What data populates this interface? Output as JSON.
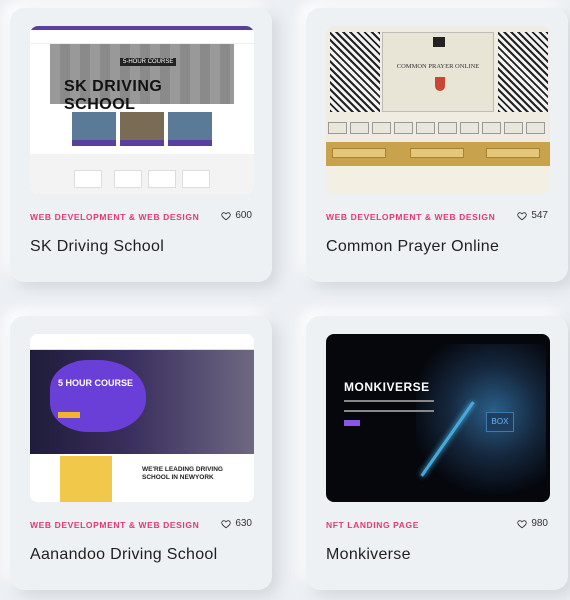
{
  "projects": [
    {
      "category": "WEB DEVELOPMENT & WEB DESIGN",
      "likes": "600",
      "title": "SK Driving School",
      "thumb": {
        "hero_text": "SK DRIVING SCHOOL",
        "badge": "5-HOUR COURSE"
      }
    },
    {
      "category": "WEB DEVELOPMENT & WEB DESIGN",
      "likes": "547",
      "title": "Common Prayer Online",
      "thumb": {
        "heading": "COMMON PRAYER ONLINE"
      }
    },
    {
      "category": "WEB DEVELOPMENT & WEB DESIGN",
      "likes": "630",
      "title": "Aanandoo Driving School",
      "thumb": {
        "hero_text": "5 HOUR COURSE",
        "lower_text": "WE'RE LEADING DRIVING SCHOOL IN NEWYORK"
      }
    },
    {
      "category": "NFT LANDING PAGE",
      "likes": "980",
      "title": "Monkiverse",
      "thumb": {
        "logo": "MONKIVERSE",
        "box_text": "BOX"
      }
    }
  ],
  "colors": {
    "category": "#e13a74",
    "card_bg": "#eef1f4",
    "page_bg": "#eceff3"
  },
  "icons": {
    "like": "heart-outline-icon"
  }
}
